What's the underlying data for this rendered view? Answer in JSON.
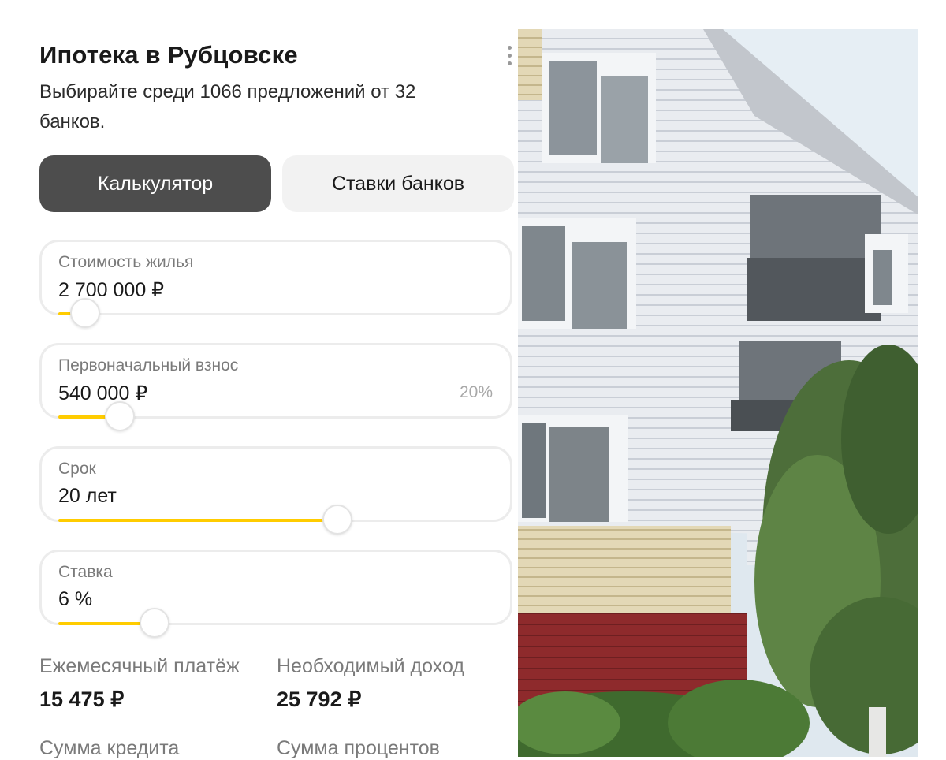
{
  "header": {
    "title": "Ипотека в Рубцовске",
    "subtitle": "Выбирайте среди 1066 предложений от 32 банков."
  },
  "tabs": [
    {
      "label": "Калькулятор",
      "active": true
    },
    {
      "label": "Ставки банков",
      "active": false
    }
  ],
  "fields": [
    {
      "label": "Стоимость жилья",
      "value": "2 700 000 ₽",
      "extra": "",
      "slider_fraction": 0.06
    },
    {
      "label": "Первоначальный взнос",
      "value": "540 000 ₽",
      "extra": "20%",
      "slider_fraction": 0.14
    },
    {
      "label": "Срок",
      "value": "20 лет",
      "extra": "",
      "slider_fraction": 0.64
    },
    {
      "label": "Ставка",
      "value": "6 %",
      "extra": "",
      "slider_fraction": 0.22
    }
  ],
  "results": {
    "monthly_label": "Ежемесячный платёж",
    "monthly_value": "15 475 ₽",
    "income_label": "Необходимый доход",
    "income_value": "25 792 ₽",
    "credit_label": "Сумма кредита",
    "interest_label": "Сумма процентов"
  },
  "colors": {
    "accent": "#ffcc00",
    "active_tab": "#4d4d4d",
    "inactive_tab": "#f2f2f2"
  },
  "icons": {
    "menu": "kebab-menu-icon",
    "photo": "apartment-building-photo"
  }
}
